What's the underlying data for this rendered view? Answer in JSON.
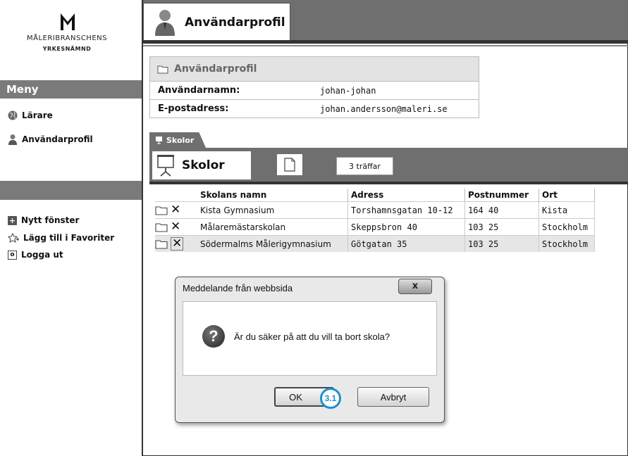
{
  "logo": {
    "line1": "MÅLERIBRANSCHENS",
    "line2": "YRKESNÄMND",
    "icon": "m-logo-icon"
  },
  "sidebar": {
    "menu_title": "Meny",
    "items": [
      {
        "label": "Lärare",
        "icon": "globe-icon"
      },
      {
        "label": "Användarprofil",
        "icon": "user-icon"
      }
    ],
    "secondary_items": [
      {
        "label": "Nytt fönster",
        "icon": "plus-square-icon"
      },
      {
        "label": "Lägg till i Favoriter",
        "icon": "star-add-icon"
      },
      {
        "label": "Logga ut",
        "icon": "logout-icon"
      }
    ]
  },
  "header": {
    "title": "Användarprofil",
    "icon": "user-avatar-icon"
  },
  "profile_panel": {
    "title": "Användarprofil",
    "rows": [
      {
        "label": "Användarnamn:",
        "value": "johan-johan"
      },
      {
        "label": "E-postadress:",
        "value": "johan.andersson@maleri.se"
      }
    ]
  },
  "schools": {
    "tab_label": "Skolor",
    "title": "Skolor",
    "count": "3 träffar",
    "columns": [
      "Skolans namn",
      "Adress",
      "Postnummer",
      "Ort"
    ],
    "rows": [
      {
        "name": "Kista Gymnasium",
        "address": "Torshamnsgatan 10-12",
        "postal": "164 40",
        "city": "Kista"
      },
      {
        "name": "Målaremästarskolan",
        "address": "Skeppsbron 40",
        "postal": "103 25",
        "city": "Stockholm"
      },
      {
        "name": "Södermalms Målerigymnasium",
        "address": "Götgatan 35",
        "postal": "103 25",
        "city": "Stockholm"
      }
    ]
  },
  "dialog": {
    "title": "Meddelande från webbsida",
    "close_label": "x",
    "message": "Är du säker på att du vill ta bort skola?",
    "ok_label": "OK",
    "cancel_label": "Avbryt"
  },
  "callout": {
    "label": "3.1",
    "color": "#1d8fcf"
  }
}
